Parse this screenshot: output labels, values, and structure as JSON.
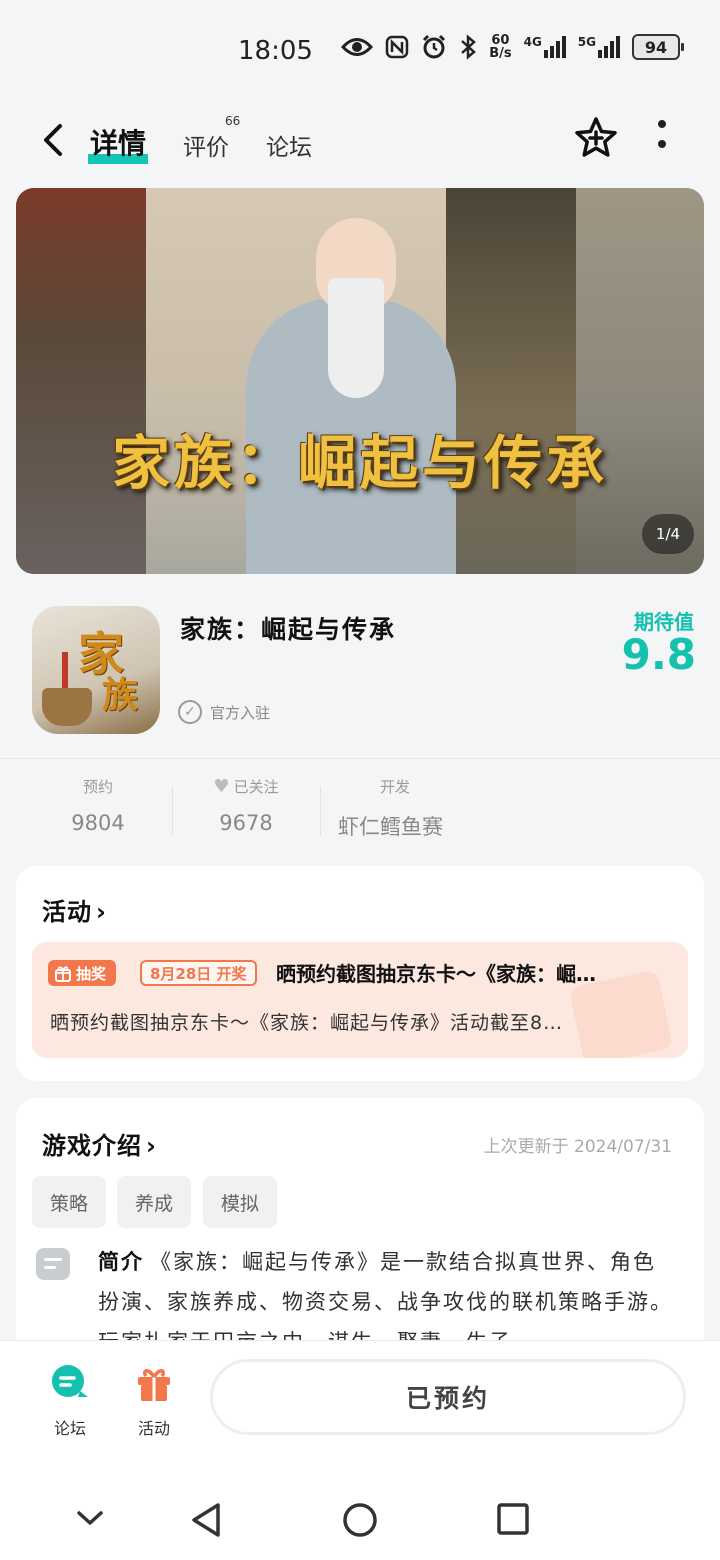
{
  "status_bar": {
    "time": "18:05",
    "net_speed_top": "60",
    "net_speed_bottom": "B/s",
    "network_1": "4G",
    "network_2": "5G",
    "battery": "94"
  },
  "nav": {
    "tabs": [
      {
        "label": "详情",
        "active": true
      },
      {
        "label": "评价",
        "badge": "66"
      },
      {
        "label": "论坛"
      }
    ]
  },
  "banner": {
    "title": "家族：崛起与传承",
    "counter": "1/4"
  },
  "app": {
    "name": "家族：崛起与传承",
    "official_label": "官方入驻",
    "expect_label": "期待值",
    "expect_score": "9.8",
    "icon_chars": [
      "家",
      "族"
    ]
  },
  "stats": {
    "reserve_label": "预约",
    "reserve_value": "9804",
    "follow_label": "已关注",
    "follow_value": "9678",
    "dev_label": "开发",
    "dev_value": "虾仁鳕鱼赛"
  },
  "activity": {
    "section_title": "活动",
    "tag_label": "抽奖",
    "date_label": "8月28日 开奖",
    "title": "晒预约截图抽京东卡～《家族：崛…",
    "description": "晒预约截图抽京东卡～《家族：崛起与传承》活动截至8…"
  },
  "intro": {
    "section_title": "游戏介绍",
    "update_time": "上次更新于 2024/07/31",
    "tags": [
      "策略",
      "养成",
      "模拟"
    ],
    "summary_label": "简介",
    "summary": "《家族：崛起与传承》是一款结合拟真世界、角色扮演、家族养成、物资交易、战争攻伐的联机策略手游。玩家扎家于田亩之中，谋生、娶妻、生子……"
  },
  "bottom_bar": {
    "forum_label": "论坛",
    "activity_label": "活动",
    "reserved_button": "已预约"
  },
  "colors": {
    "accent": "#14c0ae",
    "orange": "#f2784b",
    "activity_bg": "#fde8e0"
  }
}
